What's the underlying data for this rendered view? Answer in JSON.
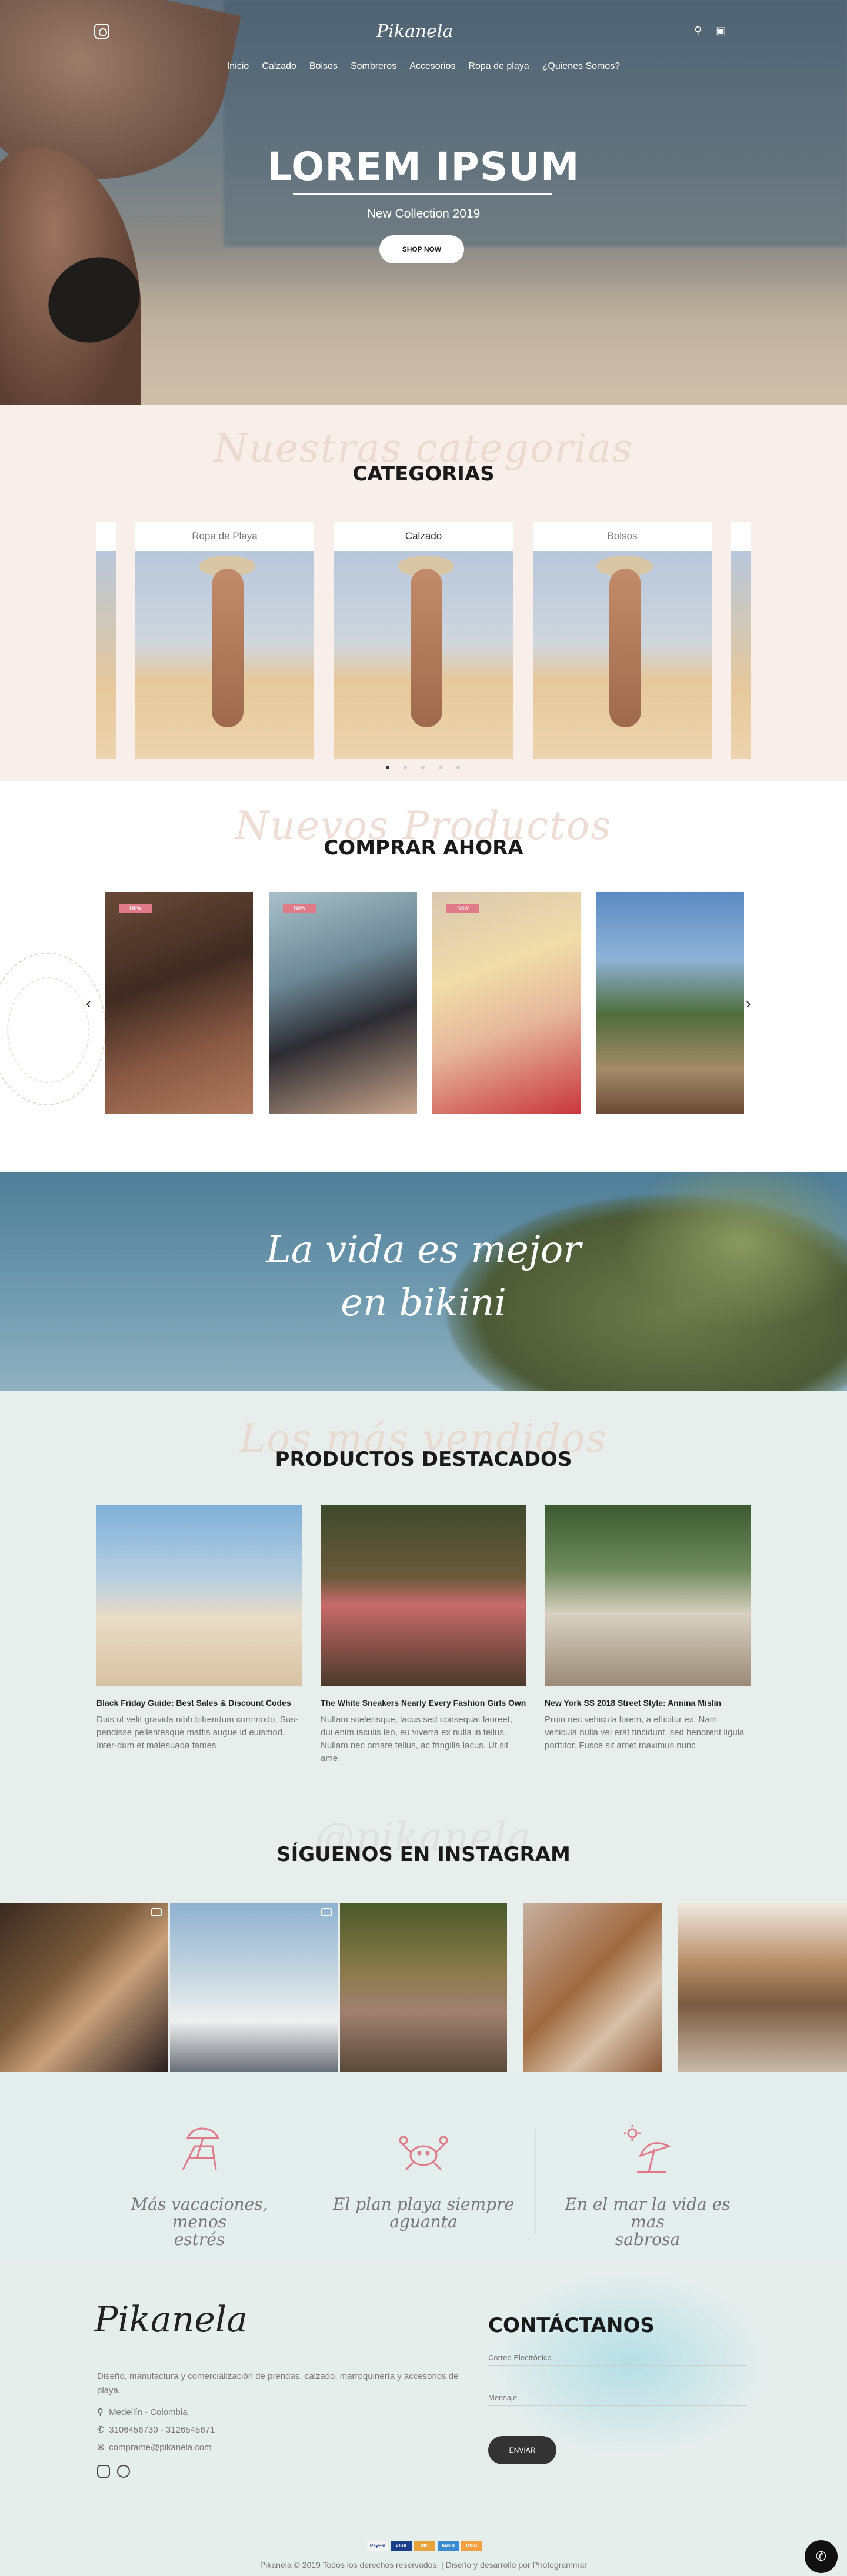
{
  "header": {
    "logo": "Pikanela",
    "nav": [
      "Inicio",
      "Calzado",
      "Bolsos",
      "Sombreros",
      "Accesorios",
      "Ropa de playa",
      "¿Quienes Somos?"
    ]
  },
  "hero": {
    "title": "LOREM IPSUM",
    "subtitle": "New Collection 2019",
    "button": "SHOP NOW"
  },
  "categories": {
    "script": "Nuestras categorias",
    "title": "CATEGORIAS",
    "items": [
      "Ropa de Playa",
      "Calzado",
      "Bolsos"
    ]
  },
  "products": {
    "script": "Nuevos Productos",
    "title": "COMPRAR AHORA",
    "badge": "New",
    "prev": "‹",
    "next": "›"
  },
  "banner": {
    "line1": "La vida es mejor",
    "line2": "en bikini"
  },
  "featured": {
    "script": "Los más vendidos",
    "title": "PRODUCTOS DESTACADOS",
    "items": [
      {
        "title": "Black Friday Guide: Best Sales & Discount Codes",
        "body": "Duis ut velit gravida nibh bibendum commodo. Sus-pendisse pellentesque mattis augue id euismod. Inter-dum et malesuada fames"
      },
      {
        "title": "The White Sneakers Nearly Every Fashion Girls Own",
        "body": "Nullam scelerisque, lacus sed consequat laoreet, dui enim iaculis leo, eu viverra ex nulla in tellus. Nullam nec ornare tellus, ac fringilla lacus. Ut sit ame"
      },
      {
        "title": "New York SS 2018 Street Style: Annina Mislin",
        "body": "Proin nec vehicula lorem, a efficitur ex. Nam vehicula nulla vel erat tincidunt, sed hendrerit ligula porttitor. Fusce sit amet maximus nunc"
      }
    ]
  },
  "instagram": {
    "script": "@pikanela",
    "title": "SÍGUENOS EN INSTAGRAM"
  },
  "features": [
    {
      "icon": "beach-chair-icon",
      "line1": "Más vacaciones, menos",
      "line2": "estrés"
    },
    {
      "icon": "crab-icon",
      "line1": "El plan playa siempre",
      "line2": "aguanta"
    },
    {
      "icon": "beach-umbrella-icon",
      "line1": "En el mar la vida es mas",
      "line2": "sabrosa"
    }
  ],
  "footer": {
    "logo": "Pikanela",
    "description": "Diseño, manufactura y comercialización de prendas, calzado, marroquinería y accesorios de playa.",
    "location": "Medellín - Colombia",
    "phone": "3106456730 - 3126545671",
    "email": "comprame@pikanela.com",
    "contact_title": "CONTÁCTANOS",
    "email_placeholder": "Correo Electrónico",
    "message_placeholder": "Mensaje",
    "send": "ENVIAR",
    "payments": [
      "PayPal",
      "VISA",
      "MC",
      "AMEX",
      "DISC"
    ],
    "copyright": "Pikanela © 2019 Todos los derechos reservados. | Diseño y desarrollo por Photogrammar"
  },
  "colors": {
    "accent_pink": "#e07a88",
    "dark": "#1a1a1a",
    "category_bg": "#f8efeb",
    "section_bg": "#e8eeec"
  }
}
